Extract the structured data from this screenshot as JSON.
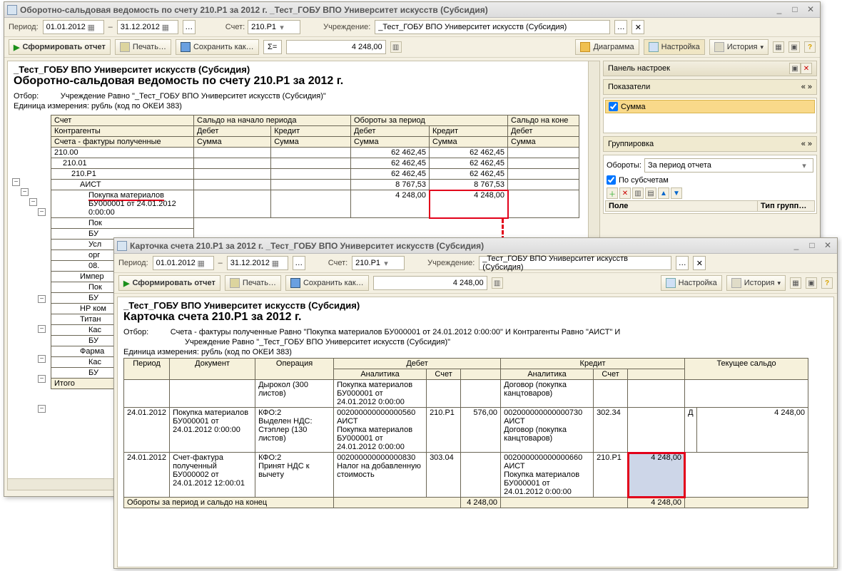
{
  "win1": {
    "title": "Оборотно-сальдовая ведомость по счету 210.Р1 за 2012 г. _Тест_ГОБУ ВПО Университет искусств (Субсидия)",
    "period_label": "Период:",
    "date_from": "01.01.2012",
    "date_to": "31.12.2012",
    "account_label": "Счет:",
    "account": "210.Р1",
    "org_label": "Учреждение:",
    "org": "_Тест_ГОБУ ВПО Университет искусств (Субсидия)",
    "form_btn": "Сформировать отчет",
    "print_btn": "Печать…",
    "save_btn": "Сохранить как…",
    "sigma": "Σ=",
    "sigma_val": "4 248,00",
    "diagram_btn": "Диаграмма",
    "settings_btn": "Настройка",
    "history_btn": "История",
    "report": {
      "org_line": "_Тест_ГОБУ ВПО Университет искусств (Субсидия)",
      "head": "Оборотно-сальдовая ведомость по счету 210.Р1 за 2012 г.",
      "otbor_l": "Отбор:",
      "otbor_v": "Учреждение Равно \"_Тест_ГОБУ ВПО Университет искусств (Субсидия)\"",
      "unit": "Единица измерения: рубль (код по ОКЕИ 383)",
      "hdr_account": "Счет",
      "hdr_open": "Сальдо на начало периода",
      "hdr_turn": "Обороты за период",
      "hdr_close": "Сальдо на коне",
      "hdr_kontr": "Контрагенты",
      "hdr_debit": "Дебет",
      "hdr_credit": "Кредит",
      "hdr_sf": "Счета - фактуры полученные",
      "hdr_sum": "Сумма",
      "rows": {
        "r1": {
          "acc": "210.00",
          "d": "62 462,45",
          "k": "62 462,45"
        },
        "r2": {
          "acc": "210.01",
          "d": "62 462,45",
          "k": "62 462,45"
        },
        "r3": {
          "acc": "210.Р1",
          "d": "62 462,45",
          "k": "62 462,45"
        },
        "r4": {
          "acc": "АИСТ",
          "d": "8 767,53",
          "k": "8 767,53"
        },
        "r5": {
          "acc": "Покупка материалов",
          "d": "4 248,00",
          "k": "4 248,00"
        },
        "r5b": {
          "acc": "БУ000001 от 24.01.2012 0:00:00"
        },
        "r6": {
          "acc": "Пок"
        },
        "r7": {
          "acc": "БУ"
        },
        "r8": {
          "acc": "Усл"
        },
        "r9": {
          "acc": "орг"
        },
        "r10": {
          "acc": "08."
        },
        "r11": {
          "acc": "Импер"
        },
        "r12": {
          "acc": "Пок"
        },
        "r13": {
          "acc": "БУ"
        },
        "r14": {
          "acc": "НР ком"
        },
        "r15": {
          "acc": "Титан"
        },
        "r16": {
          "acc": "Кас"
        },
        "r17": {
          "acc": "БУ"
        },
        "r18": {
          "acc": "Фарма"
        },
        "r19": {
          "acc": "Кас"
        },
        "r20": {
          "acc": "БУ"
        }
      },
      "total": "Итого"
    },
    "side": {
      "panel": "Панель настроек",
      "pokaz": "Показатели",
      "summa": "Сумма",
      "grupp": "Группировка",
      "turn_l": "Обороты:",
      "turn_v": "За период отчета",
      "subacc": "По субсчетам",
      "col_field": "Поле",
      "col_type": "Тип групп…"
    }
  },
  "win2": {
    "title": "Карточка счета 210.Р1 за 2012 г. _Тест_ГОБУ ВПО Университет искусств (Субсидия)",
    "period_label": "Период:",
    "date_from": "01.01.2012",
    "date_to": "31.12.2012",
    "account_label": "Счет:",
    "account": "210.Р1",
    "org_label": "Учреждение:",
    "org": "_Тест_ГОБУ ВПО Университет искусств (Субсидия)",
    "form_btn": "Сформировать отчет",
    "print_btn": "Печать…",
    "save_btn": "Сохранить как…",
    "sigma_val": "4 248,00",
    "settings_btn": "Настройка",
    "history_btn": "История",
    "report": {
      "org_line": "_Тест_ГОБУ ВПО Университет искусств (Субсидия)",
      "head": "Карточка счета 210.Р1 за 2012 г.",
      "otbor_l": "Отбор:",
      "otbor_v1": "Счета - фактуры полученные Равно \"Покупка материалов БУ000001 от 24.01.2012 0:00:00\" И Контрагенты Равно \"АИСТ\" И",
      "otbor_v2": "Учреждение Равно \"_Тест_ГОБУ ВПО Университет искусств (Субсидия)\"",
      "unit": "Единица измерения: рубль (код по ОКЕИ 383)",
      "h_period": "Период",
      "h_doc": "Документ",
      "h_op": "Операция",
      "h_deb": "Дебет",
      "h_cred": "Кредит",
      "h_bal": "Текущее сальдо",
      "h_anal": "Аналитика",
      "h_acct": "Счет",
      "r0": {
        "op": "Дырокол (300 листов)",
        "d_anal": "Покупка материалов БУ000001 от 24.01.2012 0:00:00",
        "c_anal": "Договор (покупка канцтоваров)"
      },
      "r1": {
        "per": "24.01.2012",
        "doc": "Покупка материалов БУ000001 от 24.01.2012 0:00:00",
        "op": "КФО:2\nВыделен НДС: Стэплер (130 листов)",
        "d_anal": "002000000000000560\nАИСТ\nПокупка материалов БУ000001 от 24.01.2012 0:00:00",
        "d_acc": "210.Р1",
        "d_sum": "576,00",
        "c_anal": "002000000000000730\nАИСТ\nДоговор (покупка канцтоваров)",
        "c_acc": "302.34",
        "bal_s": "Д",
        "bal": "4 248,00"
      },
      "r2": {
        "per": "24.01.2012",
        "doc": "Счет-фактура полученный БУ000002 от 24.01.2012 12:00:01",
        "op": "КФО:2\nПринят НДС к вычету",
        "d_anal": "002000000000000830\nНалог на добавленную стоимость",
        "d_acc": "303.04",
        "c_anal": "002000000000000660\nАИСТ\nПокупка материалов БУ000001 от 24.01.2012 0:00:00",
        "c_acc": "210.Р1",
        "c_sum": "4 248,00"
      },
      "footer": "Обороты за период и сальдо на конец",
      "footer_d": "4 248,00",
      "footer_c": "4 248,00"
    }
  }
}
